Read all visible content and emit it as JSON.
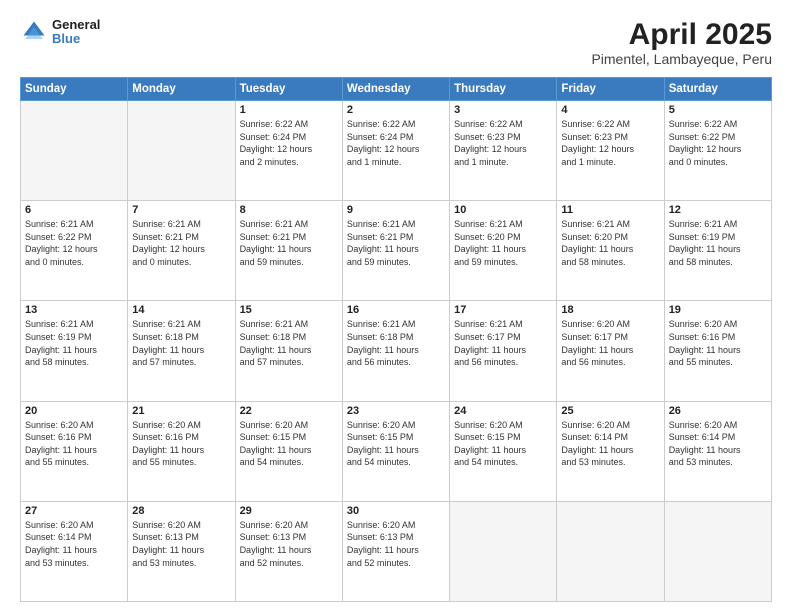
{
  "header": {
    "logo_general": "General",
    "logo_blue": "Blue",
    "title": "April 2025",
    "subtitle": "Pimentel, Lambayeque, Peru"
  },
  "days_of_week": [
    "Sunday",
    "Monday",
    "Tuesday",
    "Wednesday",
    "Thursday",
    "Friday",
    "Saturday"
  ],
  "weeks": [
    [
      {
        "num": "",
        "info": "",
        "empty": true
      },
      {
        "num": "",
        "info": "",
        "empty": true
      },
      {
        "num": "1",
        "info": "Sunrise: 6:22 AM\nSunset: 6:24 PM\nDaylight: 12 hours\nand 2 minutes."
      },
      {
        "num": "2",
        "info": "Sunrise: 6:22 AM\nSunset: 6:24 PM\nDaylight: 12 hours\nand 1 minute."
      },
      {
        "num": "3",
        "info": "Sunrise: 6:22 AM\nSunset: 6:23 PM\nDaylight: 12 hours\nand 1 minute."
      },
      {
        "num": "4",
        "info": "Sunrise: 6:22 AM\nSunset: 6:23 PM\nDaylight: 12 hours\nand 1 minute."
      },
      {
        "num": "5",
        "info": "Sunrise: 6:22 AM\nSunset: 6:22 PM\nDaylight: 12 hours\nand 0 minutes."
      }
    ],
    [
      {
        "num": "6",
        "info": "Sunrise: 6:21 AM\nSunset: 6:22 PM\nDaylight: 12 hours\nand 0 minutes."
      },
      {
        "num": "7",
        "info": "Sunrise: 6:21 AM\nSunset: 6:21 PM\nDaylight: 12 hours\nand 0 minutes."
      },
      {
        "num": "8",
        "info": "Sunrise: 6:21 AM\nSunset: 6:21 PM\nDaylight: 11 hours\nand 59 minutes."
      },
      {
        "num": "9",
        "info": "Sunrise: 6:21 AM\nSunset: 6:21 PM\nDaylight: 11 hours\nand 59 minutes."
      },
      {
        "num": "10",
        "info": "Sunrise: 6:21 AM\nSunset: 6:20 PM\nDaylight: 11 hours\nand 59 minutes."
      },
      {
        "num": "11",
        "info": "Sunrise: 6:21 AM\nSunset: 6:20 PM\nDaylight: 11 hours\nand 58 minutes."
      },
      {
        "num": "12",
        "info": "Sunrise: 6:21 AM\nSunset: 6:19 PM\nDaylight: 11 hours\nand 58 minutes."
      }
    ],
    [
      {
        "num": "13",
        "info": "Sunrise: 6:21 AM\nSunset: 6:19 PM\nDaylight: 11 hours\nand 58 minutes."
      },
      {
        "num": "14",
        "info": "Sunrise: 6:21 AM\nSunset: 6:18 PM\nDaylight: 11 hours\nand 57 minutes."
      },
      {
        "num": "15",
        "info": "Sunrise: 6:21 AM\nSunset: 6:18 PM\nDaylight: 11 hours\nand 57 minutes."
      },
      {
        "num": "16",
        "info": "Sunrise: 6:21 AM\nSunset: 6:18 PM\nDaylight: 11 hours\nand 56 minutes."
      },
      {
        "num": "17",
        "info": "Sunrise: 6:21 AM\nSunset: 6:17 PM\nDaylight: 11 hours\nand 56 minutes."
      },
      {
        "num": "18",
        "info": "Sunrise: 6:20 AM\nSunset: 6:17 PM\nDaylight: 11 hours\nand 56 minutes."
      },
      {
        "num": "19",
        "info": "Sunrise: 6:20 AM\nSunset: 6:16 PM\nDaylight: 11 hours\nand 55 minutes."
      }
    ],
    [
      {
        "num": "20",
        "info": "Sunrise: 6:20 AM\nSunset: 6:16 PM\nDaylight: 11 hours\nand 55 minutes."
      },
      {
        "num": "21",
        "info": "Sunrise: 6:20 AM\nSunset: 6:16 PM\nDaylight: 11 hours\nand 55 minutes."
      },
      {
        "num": "22",
        "info": "Sunrise: 6:20 AM\nSunset: 6:15 PM\nDaylight: 11 hours\nand 54 minutes."
      },
      {
        "num": "23",
        "info": "Sunrise: 6:20 AM\nSunset: 6:15 PM\nDaylight: 11 hours\nand 54 minutes."
      },
      {
        "num": "24",
        "info": "Sunrise: 6:20 AM\nSunset: 6:15 PM\nDaylight: 11 hours\nand 54 minutes."
      },
      {
        "num": "25",
        "info": "Sunrise: 6:20 AM\nSunset: 6:14 PM\nDaylight: 11 hours\nand 53 minutes."
      },
      {
        "num": "26",
        "info": "Sunrise: 6:20 AM\nSunset: 6:14 PM\nDaylight: 11 hours\nand 53 minutes."
      }
    ],
    [
      {
        "num": "27",
        "info": "Sunrise: 6:20 AM\nSunset: 6:14 PM\nDaylight: 11 hours\nand 53 minutes."
      },
      {
        "num": "28",
        "info": "Sunrise: 6:20 AM\nSunset: 6:13 PM\nDaylight: 11 hours\nand 53 minutes."
      },
      {
        "num": "29",
        "info": "Sunrise: 6:20 AM\nSunset: 6:13 PM\nDaylight: 11 hours\nand 52 minutes."
      },
      {
        "num": "30",
        "info": "Sunrise: 6:20 AM\nSunset: 6:13 PM\nDaylight: 11 hours\nand 52 minutes."
      },
      {
        "num": "",
        "info": "",
        "empty": true
      },
      {
        "num": "",
        "info": "",
        "empty": true
      },
      {
        "num": "",
        "info": "",
        "empty": true
      }
    ]
  ]
}
